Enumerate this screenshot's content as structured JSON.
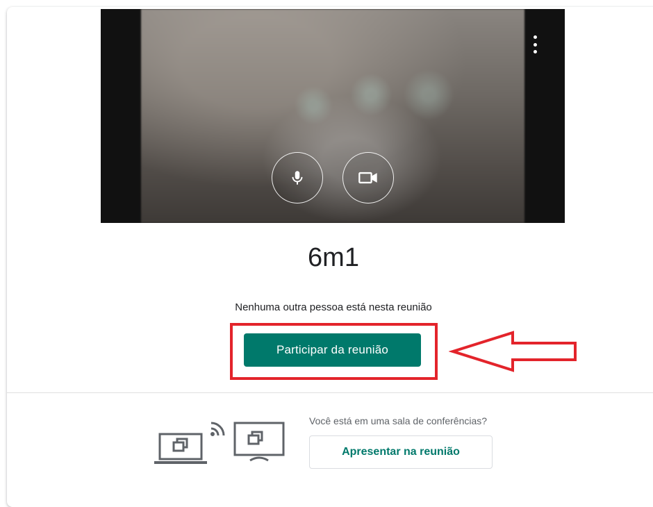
{
  "meeting": {
    "title": "6m1",
    "status_text": "Nenhuma outra pessoa está nesta reunião",
    "join_label": "Participar da reunião"
  },
  "preview": {
    "controls": [
      {
        "name": "mic-toggle",
        "icon": "microphone-icon"
      },
      {
        "name": "camera-toggle",
        "icon": "video-camera-icon"
      }
    ],
    "menu_icon": "more-vert-icon"
  },
  "room": {
    "question": "Você está em uma sala de conferências?",
    "present_label": "Apresentar na reunião",
    "illustration_icons": [
      "laptop-icon",
      "cast-signal-icon",
      "tv-monitor-icon"
    ]
  },
  "colors": {
    "accent": "#00796b",
    "annotation": "#e3242b"
  }
}
